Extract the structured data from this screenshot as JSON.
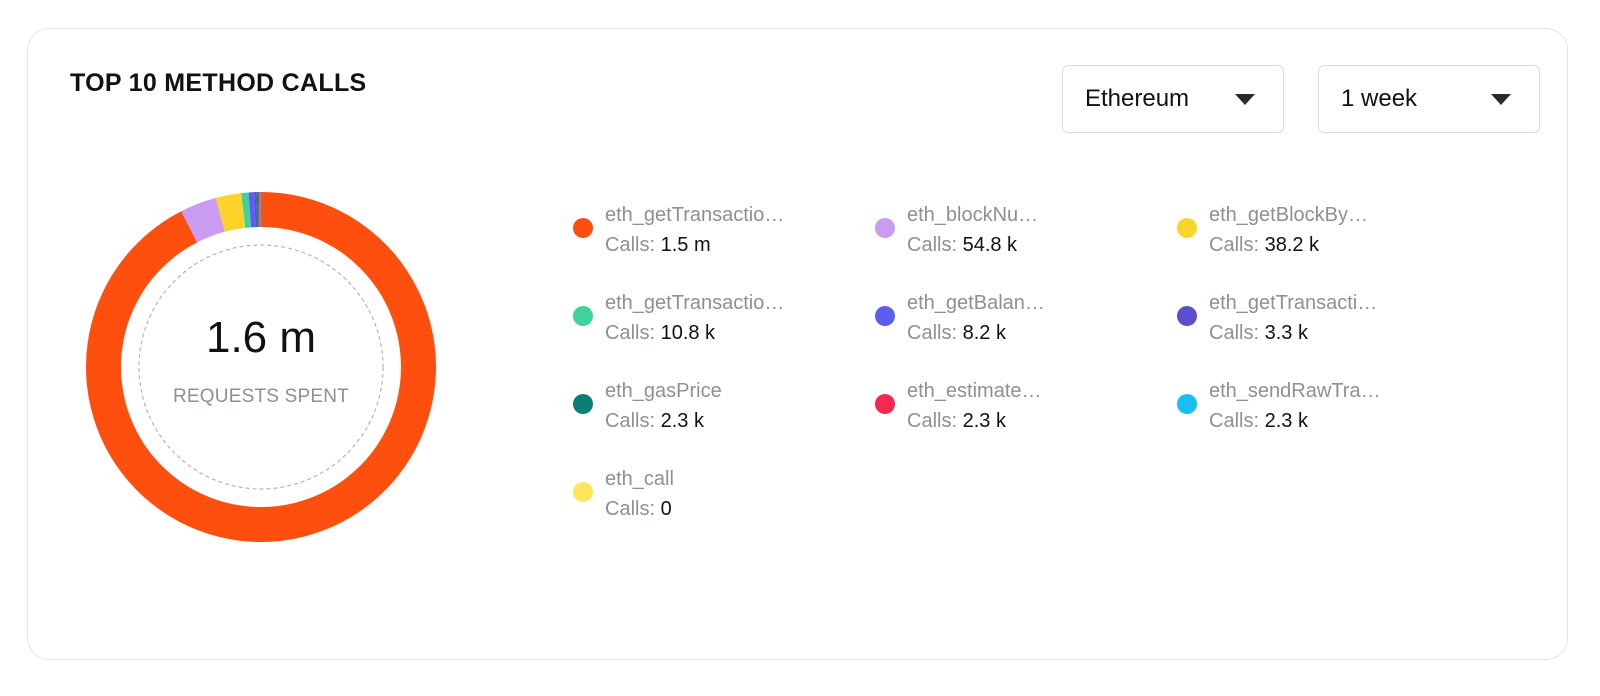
{
  "card": {
    "title": "TOP 10 METHOD CALLS",
    "network_select": {
      "value": "Ethereum"
    },
    "period_select": {
      "value": "1 week"
    }
  },
  "chart_data": {
    "type": "pie",
    "donut": true,
    "title": "TOP 10 METHOD CALLS",
    "center_value": "1.6 m",
    "center_label": "REQUESTS SPENT",
    "calls_label": "Calls:",
    "legend_placement": "right",
    "series": [
      {
        "name": "eth_getTransactio…",
        "value": 1500000,
        "label": "1.5 m",
        "color": "#ff4f0f"
      },
      {
        "name": "eth_blockNu…",
        "value": 54800,
        "label": "54.8 k",
        "color": "#c99cf2"
      },
      {
        "name": "eth_getBlockBy…",
        "value": 38200,
        "label": "38.2 k",
        "color": "#ffd42a"
      },
      {
        "name": "eth_getTransactio…",
        "value": 10800,
        "label": "10.8 k",
        "color": "#3fd39b"
      },
      {
        "name": "eth_getBalan…",
        "value": 8200,
        "label": "8.2 k",
        "color": "#5b5ef0"
      },
      {
        "name": "eth_getTransacti…",
        "value": 3300,
        "label": "3.3 k",
        "color": "#5a4fcf"
      },
      {
        "name": "eth_gasPrice",
        "value": 2300,
        "label": "2.3 k",
        "color": "#0b7e76"
      },
      {
        "name": "eth_estimate…",
        "value": 2300,
        "label": "2.3 k",
        "color": "#f5284f"
      },
      {
        "name": "eth_sendRawTra…",
        "value": 2300,
        "label": "2.3 k",
        "color": "#16bff0"
      },
      {
        "name": "eth_call",
        "value": 0,
        "label": "0",
        "color": "#ffe55c"
      }
    ]
  }
}
